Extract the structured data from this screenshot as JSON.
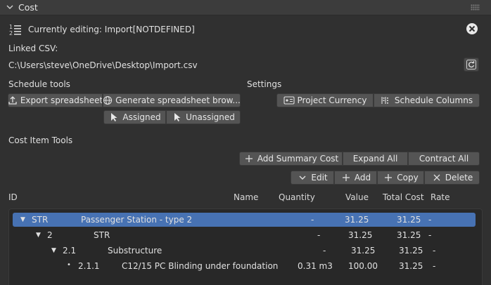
{
  "header": {
    "title": "Cost"
  },
  "editing": {
    "label": "Currently editing: Import[NOTDEFINED]"
  },
  "linked_csv": {
    "label": "Linked CSV:",
    "path": "C:\\Users\\steve\\OneDrive\\Desktop\\Import.csv"
  },
  "schedule_tools": {
    "label": "Schedule tools",
    "export": "Export spreadsheet",
    "generate": "Generate spreadsheet brow...",
    "assigned": "Assigned",
    "unassigned": "Unassigned"
  },
  "settings": {
    "label": "Settings",
    "project_currency": "Project Currency",
    "schedule_columns": "Schedule Columns"
  },
  "cost_item_tools": {
    "label": "Cost Item Tools",
    "add_summary": "Add Summary Cost",
    "expand_all": "Expand All",
    "contract_all": "Contract All",
    "edit": "Edit",
    "add": "Add",
    "copy": "Copy",
    "delete": "Delete"
  },
  "columns": {
    "id": "ID",
    "name": "Name",
    "quantity": "Quantity",
    "value": "Value",
    "total_cost": "Total Cost",
    "rate": "Rate"
  },
  "rows": [
    {
      "arrow": "▼",
      "id": "STR",
      "name": "Passenger Station - type 2",
      "quantity": "-",
      "value": "31.25",
      "total": "31.25",
      "rate": "-",
      "selected": true
    },
    {
      "arrow": "▼",
      "id": "2",
      "name": "STR",
      "quantity": "-",
      "value": "31.25",
      "total": "31.25",
      "rate": "-"
    },
    {
      "arrow": "▼",
      "id": "2.1",
      "name": "Substructure",
      "quantity": "-",
      "value": "31.25",
      "total": "31.25",
      "rate": "-"
    },
    {
      "arrow": "•",
      "id": "2.1.1",
      "name": "C12/15 PC Blinding under foundation",
      "quantity": "0.31 m3",
      "value": "100.00",
      "total": "31.25",
      "rate": "-"
    }
  ],
  "icons": [
    "chevron-down-icon",
    "list-numbered-icon",
    "close-icon",
    "refresh-icon",
    "export-icon",
    "globe-icon",
    "cursor-icon",
    "currency-icon",
    "columns-icon",
    "plus-icon",
    "edit-chevron-icon",
    "x-icon"
  ],
  "colors": {
    "selection": "#4772b3",
    "panel": "#303030",
    "button": "#545454"
  }
}
